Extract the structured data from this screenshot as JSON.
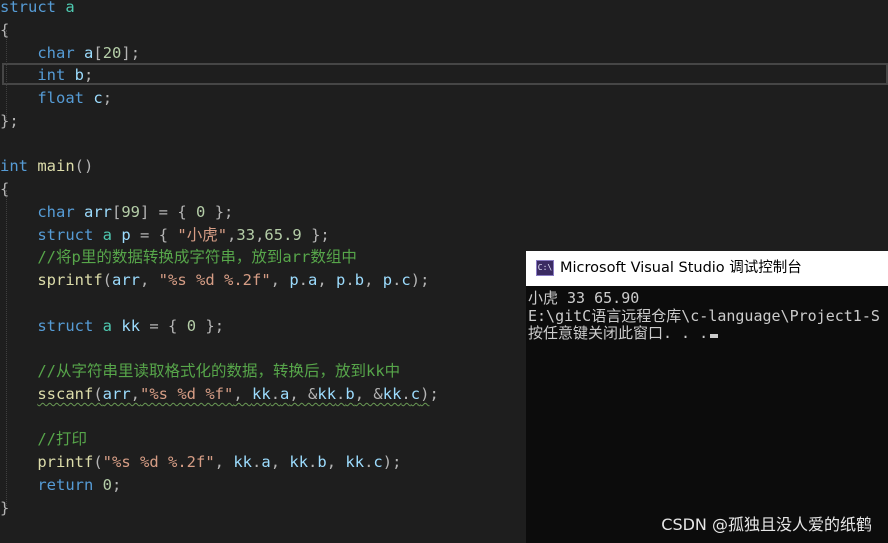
{
  "editor": {
    "lines": [
      [
        [
          "kw",
          "struct"
        ],
        [
          "pn",
          " "
        ],
        [
          "tp",
          "a"
        ]
      ],
      [
        [
          "pn",
          "{"
        ]
      ],
      [
        [
          "pn",
          "    "
        ],
        [
          "kw",
          "char"
        ],
        [
          "pn",
          " "
        ],
        [
          "vr",
          "a"
        ],
        [
          "pn",
          "["
        ],
        [
          "nm",
          "20"
        ],
        [
          "pn",
          "];"
        ]
      ],
      [
        [
          "pn",
          "    "
        ],
        [
          "kw",
          "int"
        ],
        [
          "pn",
          " "
        ],
        [
          "vr",
          "b"
        ],
        [
          "pn",
          ";"
        ]
      ],
      [
        [
          "pn",
          "    "
        ],
        [
          "kw",
          "float"
        ],
        [
          "pn",
          " "
        ],
        [
          "vr",
          "c"
        ],
        [
          "pn",
          ";"
        ]
      ],
      [
        [
          "pn",
          "};"
        ]
      ],
      [],
      [
        [
          "kw",
          "int"
        ],
        [
          "pn",
          " "
        ],
        [
          "fn",
          "main"
        ],
        [
          "pn",
          "()"
        ]
      ],
      [
        [
          "pn",
          "{"
        ]
      ],
      [
        [
          "pn",
          "    "
        ],
        [
          "kw",
          "char"
        ],
        [
          "pn",
          " "
        ],
        [
          "vr",
          "arr"
        ],
        [
          "pn",
          "["
        ],
        [
          "nm",
          "99"
        ],
        [
          "pn",
          "] = { "
        ],
        [
          "nm",
          "0"
        ],
        [
          "pn",
          " };"
        ]
      ],
      [
        [
          "pn",
          "    "
        ],
        [
          "kw",
          "struct"
        ],
        [
          "pn",
          " "
        ],
        [
          "tp",
          "a"
        ],
        [
          "pn",
          " "
        ],
        [
          "vr",
          "p"
        ],
        [
          "pn",
          " = { "
        ],
        [
          "st",
          "\"小虎\""
        ],
        [
          "pn",
          ","
        ],
        [
          "nm",
          "33"
        ],
        [
          "pn",
          ","
        ],
        [
          "nm",
          "65.9"
        ],
        [
          "pn",
          " };"
        ]
      ],
      [
        [
          "pn",
          "    "
        ],
        [
          "cm",
          "//将p里的数据转换成字符串，放到arr数组中"
        ]
      ],
      [
        [
          "pn",
          "    "
        ],
        [
          "fn",
          "sprintf"
        ],
        [
          "pn",
          "("
        ],
        [
          "vr",
          "arr"
        ],
        [
          "pn",
          ", "
        ],
        [
          "st",
          "\"%s %d %.2f\""
        ],
        [
          "pn",
          ", "
        ],
        [
          "vr",
          "p"
        ],
        [
          "pn",
          "."
        ],
        [
          "vr",
          "a"
        ],
        [
          "pn",
          ", "
        ],
        [
          "vr",
          "p"
        ],
        [
          "pn",
          "."
        ],
        [
          "vr",
          "b"
        ],
        [
          "pn",
          ", "
        ],
        [
          "vr",
          "p"
        ],
        [
          "pn",
          "."
        ],
        [
          "vr",
          "c"
        ],
        [
          "pn",
          ");"
        ]
      ],
      [],
      [
        [
          "pn",
          "    "
        ],
        [
          "kw",
          "struct"
        ],
        [
          "pn",
          " "
        ],
        [
          "tp",
          "a"
        ],
        [
          "pn",
          " "
        ],
        [
          "vr",
          "kk"
        ],
        [
          "pn",
          " = { "
        ],
        [
          "nm",
          "0"
        ],
        [
          "pn",
          " };"
        ]
      ],
      [],
      [
        [
          "pn",
          "    "
        ],
        [
          "cm",
          "//从字符串里读取格式化的数据，转换后，放到kk中"
        ]
      ],
      [
        [
          "pn",
          "    "
        ],
        [
          "fn squig",
          "sscanf"
        ],
        [
          "pn squig",
          "("
        ],
        [
          "vr squig",
          "arr"
        ],
        [
          "pn squig",
          ","
        ],
        [
          "st squig",
          "\"%s %d %f\""
        ],
        [
          "pn squig",
          ", "
        ],
        [
          "vr squig",
          "kk"
        ],
        [
          "pn squig",
          "."
        ],
        [
          "vr squig",
          "a"
        ],
        [
          "pn squig",
          ", &"
        ],
        [
          "vr squig",
          "kk"
        ],
        [
          "pn squig",
          "."
        ],
        [
          "vr squig",
          "b"
        ],
        [
          "pn squig",
          ", &"
        ],
        [
          "vr squig",
          "kk"
        ],
        [
          "pn squig",
          "."
        ],
        [
          "vr squig",
          "c"
        ],
        [
          "pn squig",
          ")"
        ],
        [
          "pn",
          ";"
        ]
      ],
      [],
      [
        [
          "pn",
          "    "
        ],
        [
          "cm",
          "//打印"
        ]
      ],
      [
        [
          "pn",
          "    "
        ],
        [
          "fn",
          "printf"
        ],
        [
          "pn",
          "("
        ],
        [
          "st",
          "\"%s %d %.2f\""
        ],
        [
          "pn",
          ", "
        ],
        [
          "vr",
          "kk"
        ],
        [
          "pn",
          "."
        ],
        [
          "vr",
          "a"
        ],
        [
          "pn",
          ", "
        ],
        [
          "vr",
          "kk"
        ],
        [
          "pn",
          "."
        ],
        [
          "vr",
          "b"
        ],
        [
          "pn",
          ", "
        ],
        [
          "vr",
          "kk"
        ],
        [
          "pn",
          "."
        ],
        [
          "vr",
          "c"
        ],
        [
          "pn",
          ");"
        ]
      ],
      [
        [
          "pn",
          "    "
        ],
        [
          "kw",
          "return"
        ],
        [
          "pn",
          " "
        ],
        [
          "nm",
          "0"
        ],
        [
          "pn",
          ";"
        ]
      ],
      [
        [
          "pn",
          "}"
        ]
      ]
    ]
  },
  "console": {
    "title": "Microsoft Visual Studio 调试控制台",
    "icon_label": "C:\\",
    "output": [
      "小虎 33 65.90",
      "E:\\gitC语言远程仓库\\c-language\\Project1-S",
      "按任意键关闭此窗口. . ."
    ]
  },
  "watermark": "CSDN @孤独且没人爱的纸鹤",
  "colors": {
    "editor_bg": "#1e1e1e",
    "keyword": "#569cd6",
    "variable": "#9cdcfe",
    "function": "#dcdcaa",
    "number": "#b5cea8",
    "string": "#d69d85",
    "comment": "#57a64a",
    "type": "#4ec9b0",
    "console_bg": "#0c0c0c"
  }
}
